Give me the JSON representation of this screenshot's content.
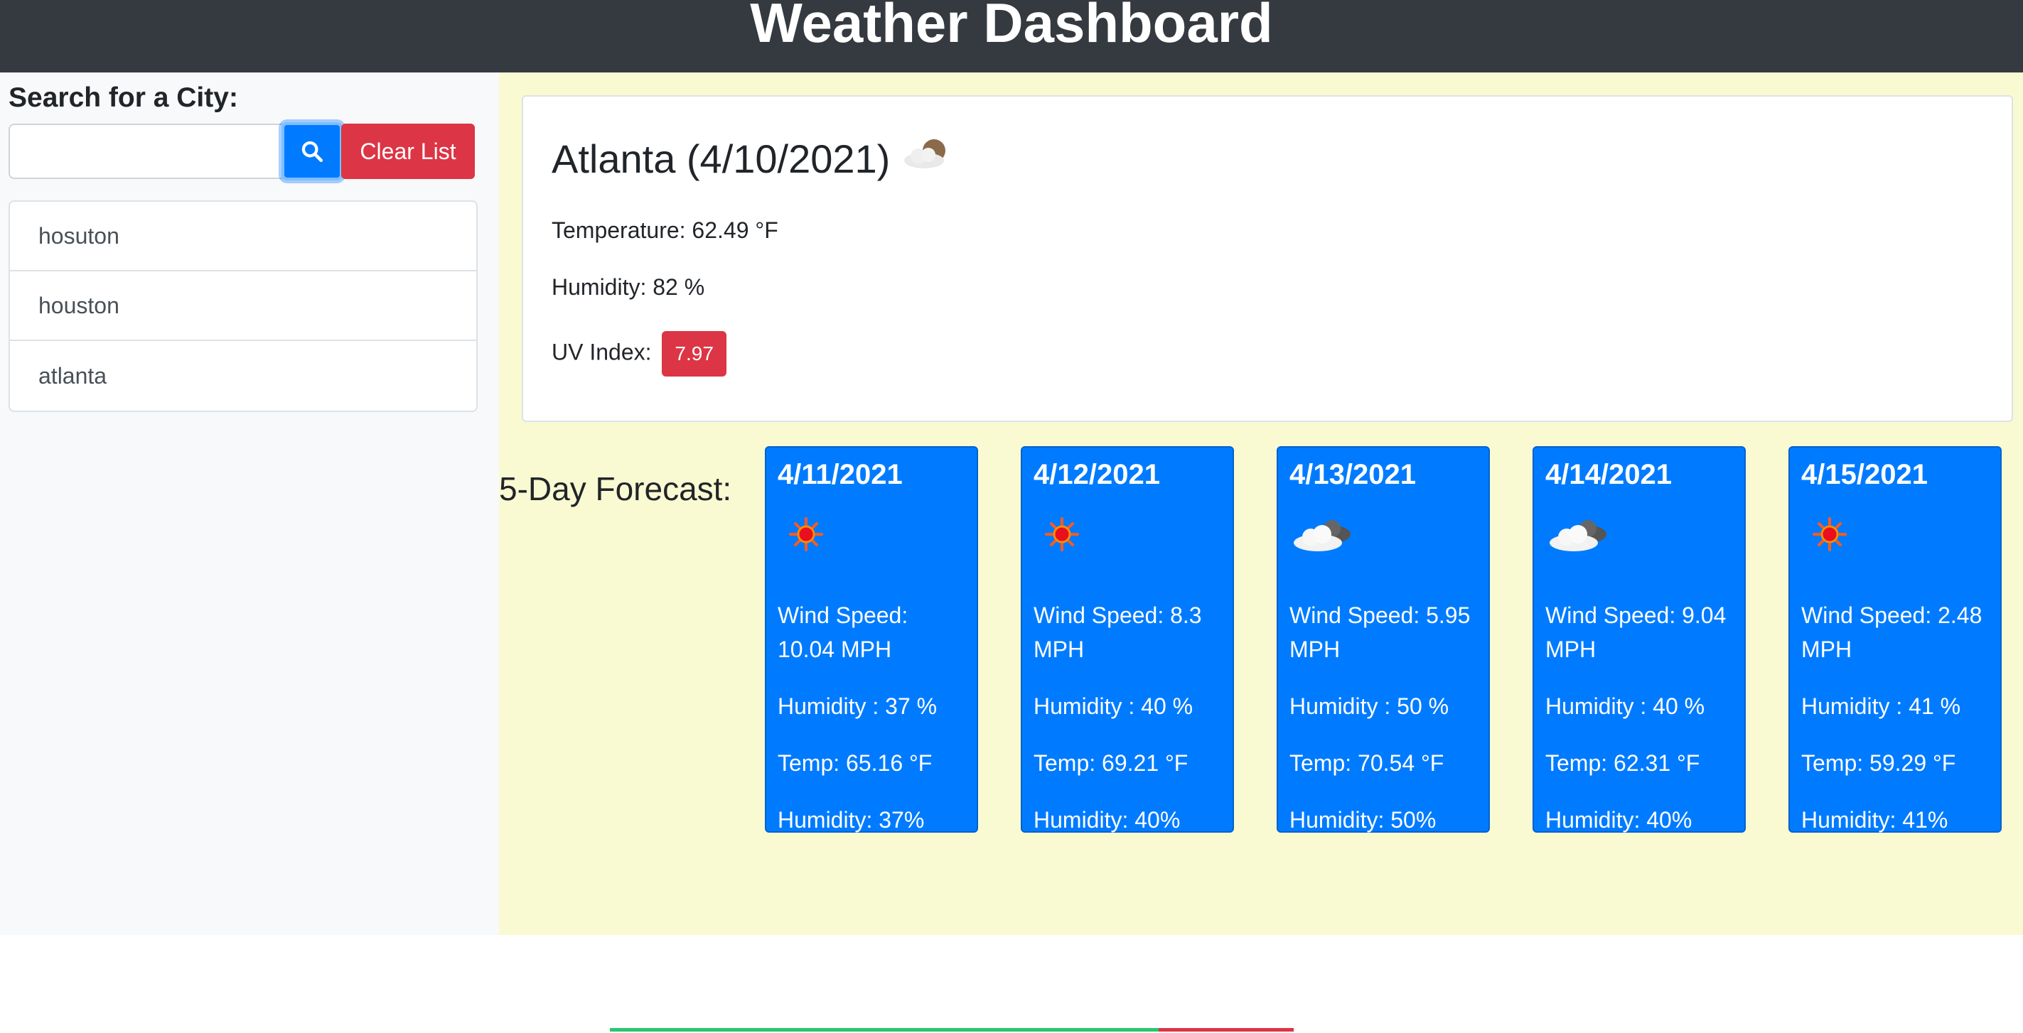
{
  "header": {
    "title": "Weather Dashboard"
  },
  "sidebar": {
    "search_label": "Search for a City:",
    "search_placeholder": "",
    "search_value": "",
    "clear_label": "Clear List",
    "history": [
      "hosuton",
      "houston",
      "atlanta"
    ]
  },
  "current": {
    "title": "Atlanta (4/10/2021)",
    "icon": "partly-cloudy-icon",
    "temperature": "Temperature: 62.49 °F",
    "humidity": "Humidity: 82 %",
    "uv_label": "UV Index:",
    "uv_value": "7.97",
    "uv_color": "#dc3545"
  },
  "forecast": {
    "title": "5-Day Forecast:",
    "days": [
      {
        "date": "4/11/2021",
        "icon": "sun-icon",
        "wind_label": "Wind Speed:",
        "wind_value": "10.04 MPH",
        "humidity1": "Humidity : 37 %",
        "temp": "Temp: 65.16 °F",
        "humidity2": "Humidity: 37%"
      },
      {
        "date": "4/12/2021",
        "icon": "sun-icon",
        "wind_label": "Wind Speed: 8.3",
        "wind_value": "MPH",
        "humidity1": "Humidity : 40 %",
        "temp": "Temp: 69.21 °F",
        "humidity2": "Humidity: 40%"
      },
      {
        "date": "4/13/2021",
        "icon": "cloud-icon",
        "wind_label": "Wind Speed: 5.95",
        "wind_value": "MPH",
        "humidity1": "Humidity : 50 %",
        "temp": "Temp: 70.54 °F",
        "humidity2": "Humidity: 50%"
      },
      {
        "date": "4/14/2021",
        "icon": "cloud-icon",
        "wind_label": "Wind Speed: 9.04",
        "wind_value": "MPH",
        "humidity1": "Humidity : 40 %",
        "temp": "Temp: 62.31 °F",
        "humidity2": "Humidity: 40%"
      },
      {
        "date": "4/15/2021",
        "icon": "sun-icon",
        "wind_label": "Wind Speed: 2.48",
        "wind_value": "MPH",
        "humidity1": "Humidity : 41 %",
        "temp": "Temp: 59.29 °F",
        "humidity2": "Humidity: 41%"
      }
    ]
  },
  "colors": {
    "header_bg": "#343a40",
    "sidebar_bg": "#f8f9fa",
    "main_bg": "#fafad2",
    "primary": "#007bff",
    "danger": "#dc3545",
    "progress_green": "#28c76f"
  }
}
